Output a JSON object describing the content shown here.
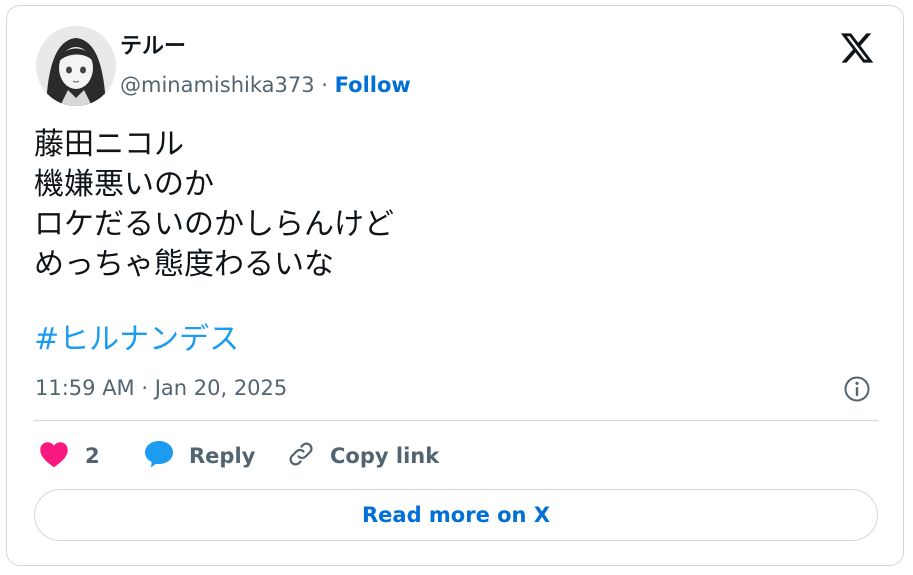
{
  "tweet": {
    "display_name": "テルー",
    "handle": "@minamishika373",
    "separator": "·",
    "follow_label": "Follow",
    "text": "藤田ニコル\n機嫌悪いのか\nロケだるいのかしらんけど\nめっちゃ態度わるいな",
    "hashtag": "#ヒルナンデス",
    "timestamp": "11:59 AM · Jan 20, 2025"
  },
  "actions": {
    "like_count": "2",
    "reply_label": "Reply",
    "copy_link_label": "Copy link"
  },
  "footer": {
    "read_more_label": "Read more on X"
  },
  "icons": {
    "logo": "x-logo-icon",
    "info": "info-icon",
    "like": "heart-icon",
    "reply": "speech-bubble-icon",
    "copy": "link-icon"
  },
  "colors": {
    "like": "#f91880",
    "reply": "#1d9bf0",
    "hashtag": "#1d9bf0",
    "follow": "#006fd6",
    "muted": "#536471",
    "border": "#cfd9de"
  }
}
